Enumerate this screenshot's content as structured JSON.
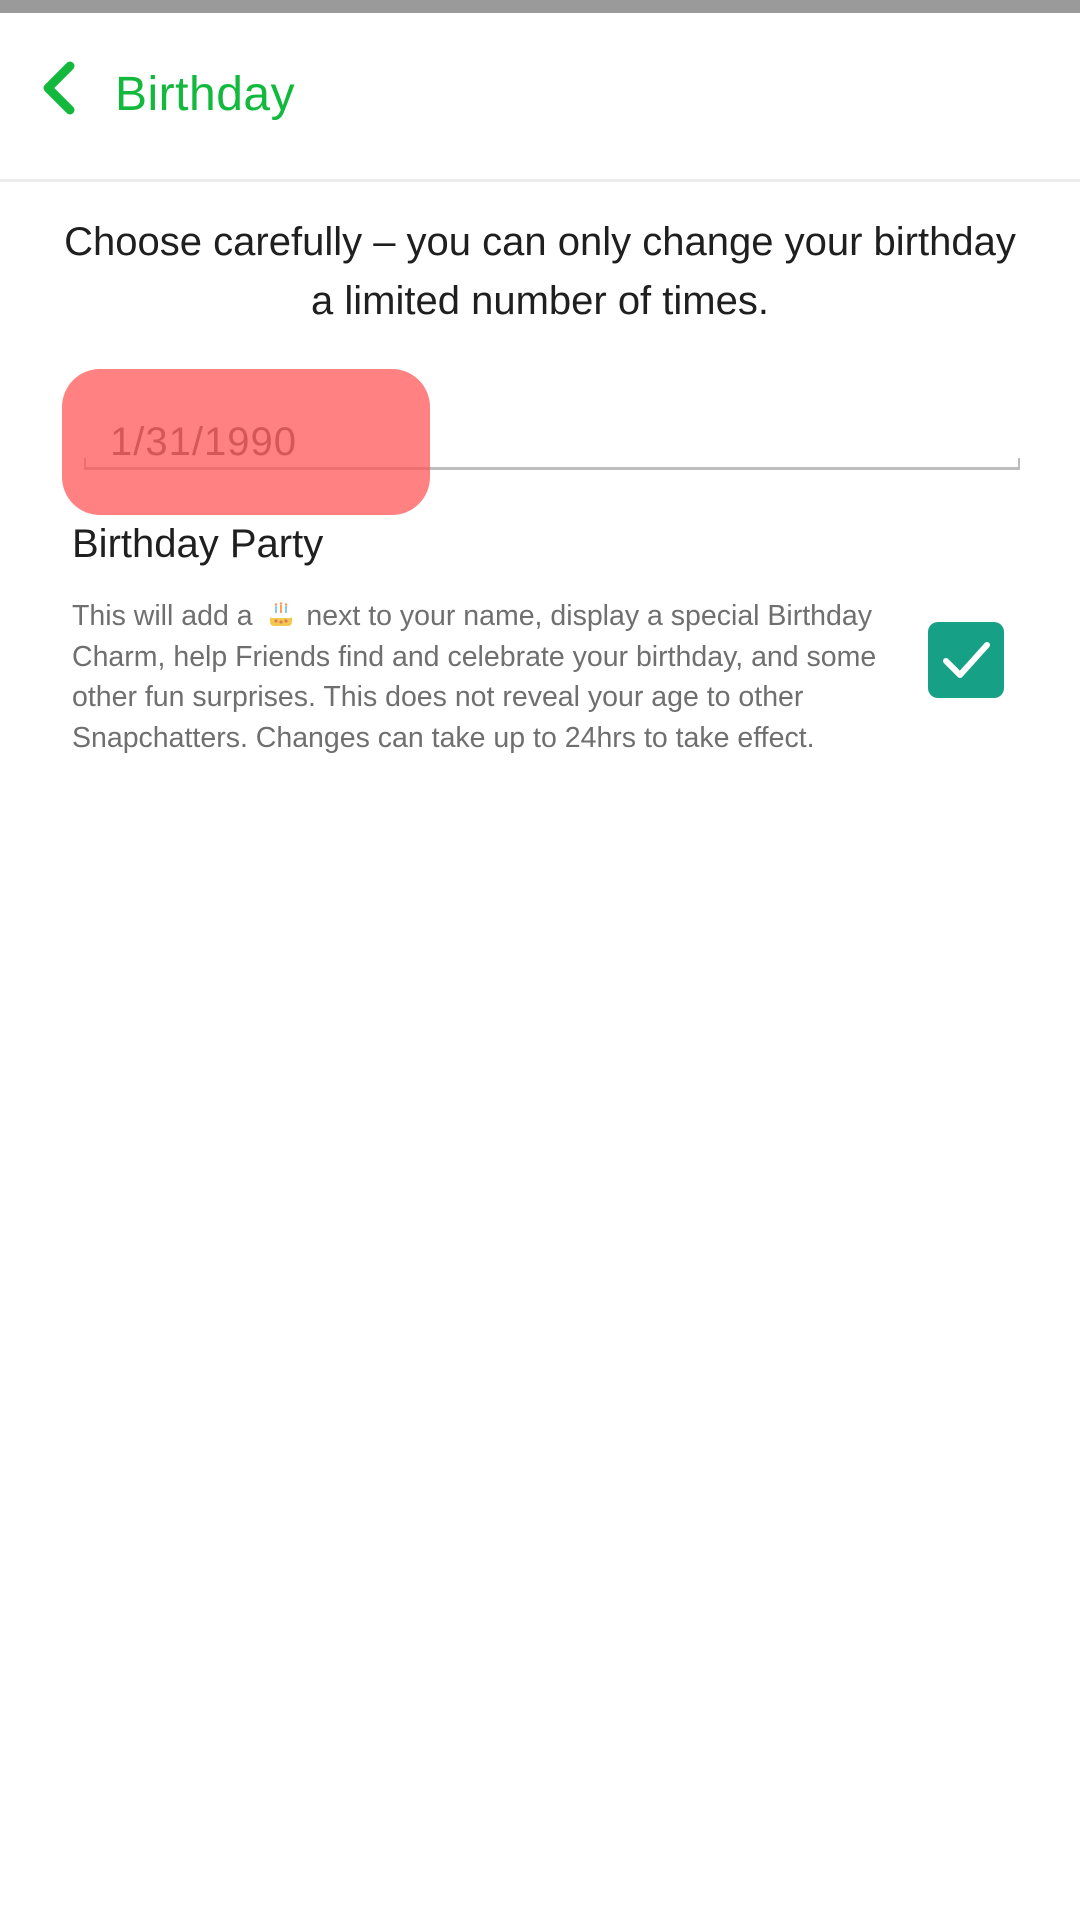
{
  "header": {
    "title": "Birthday",
    "back_icon": "chevron-left-icon",
    "accent_color": "#12b93c"
  },
  "notice": {
    "text": "Choose carefully – you can only change your birthday a limited number of times."
  },
  "birthday_field": {
    "value": "1/31/1990"
  },
  "birthday_party": {
    "title": "Birthday Party",
    "desc_before_icon": "This will add a",
    "desc_icon": "cake-icon",
    "desc_after_icon": "next to your name, display a special Birthday Charm, help Friends find and celebrate your birthday, and some other fun surprises. This does not reveal your age to other Snapchatters. Changes can take up to 24hrs to take effect.",
    "checked": true,
    "checkbox_color": "#16a085"
  },
  "highlight": {
    "color": "#ff5050"
  }
}
